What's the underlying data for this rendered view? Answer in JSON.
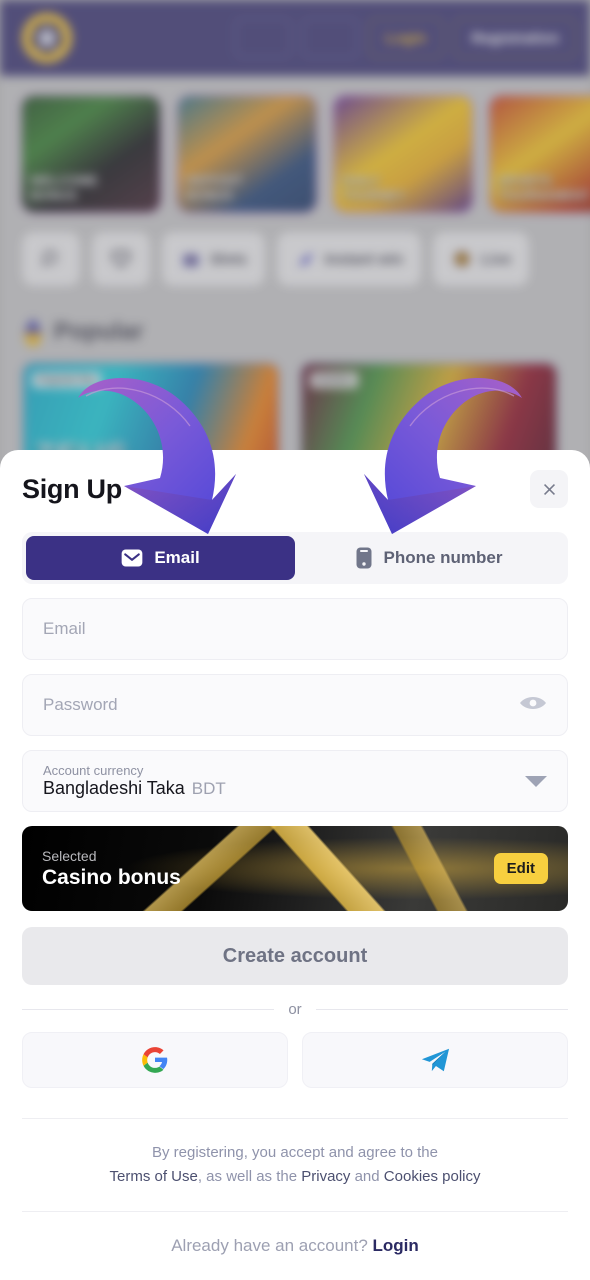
{
  "background": {
    "header": {
      "logo_icon": "star-circle-logo",
      "buttons": [
        {
          "name": "flag-selector-1",
          "label": ""
        },
        {
          "name": "flag-selector-2",
          "label": ""
        },
        {
          "name": "login-button",
          "label": "Login"
        },
        {
          "name": "registration-button",
          "label": "Registration"
        }
      ]
    },
    "banners": [
      {
        "line1": "WELCOME",
        "line2": "BONUS"
      },
      {
        "line1": "DEPOSIT",
        "line2": "BONUS"
      },
      {
        "line1": "DAILY",
        "line2": "TOURNEY"
      },
      {
        "line1": "SPORTS",
        "line2": "TOURNAMENT"
      }
    ],
    "nav_chips": [
      {
        "icon": "search-icon",
        "label": ""
      },
      {
        "icon": "heart-icon",
        "label": ""
      },
      {
        "icon": "slots-icon",
        "label": "Slots"
      },
      {
        "icon": "rocket-icon",
        "label": "Instant win"
      },
      {
        "icon": "live-icon",
        "label": "Live"
      }
    ],
    "section": {
      "icon": "flame-icon",
      "title": "Popular"
    },
    "games": [
      {
        "tag": "Pragmatic Play",
        "title": "ZEUS"
      },
      {
        "tag": "Evolution",
        "title": ""
      }
    ]
  },
  "modal": {
    "title": "Sign Up",
    "close_icon": "close-icon",
    "tabs": [
      {
        "label": "Email",
        "icon": "envelope-icon",
        "active": true
      },
      {
        "label": "Phone number",
        "icon": "phone-icon",
        "active": false
      }
    ],
    "fields": {
      "email": {
        "placeholder": "Email",
        "value": ""
      },
      "password": {
        "placeholder": "Password",
        "value": "",
        "toggle_icon": "eye-icon"
      },
      "currency": {
        "label": "Account currency",
        "value": "Bangladeshi Taka",
        "code": "BDT",
        "caret_icon": "chevron-down-icon"
      }
    },
    "bonus": {
      "selected_label": "Selected",
      "name": "Casino bonus",
      "edit_label": "Edit"
    },
    "submit_label": "Create account",
    "divider_label": "or",
    "social": [
      {
        "name": "google-login-button",
        "icon": "google-icon"
      },
      {
        "name": "telegram-login-button",
        "icon": "telegram-icon"
      }
    ],
    "legal": {
      "line1": "By registering, you accept and agree to the",
      "terms": "Terms of Use",
      "mid": ", as well as the ",
      "privacy": "Privacy",
      "and": " and ",
      "cookies": "Cookies policy"
    },
    "footer": {
      "text": "Already have an account?",
      "login_label": "Login"
    }
  },
  "colors": {
    "accent": "#3b3185",
    "bonus_edit": "#f7cf3f",
    "arrow_start": "#5a5ae0",
    "arrow_end": "#b857c8"
  }
}
